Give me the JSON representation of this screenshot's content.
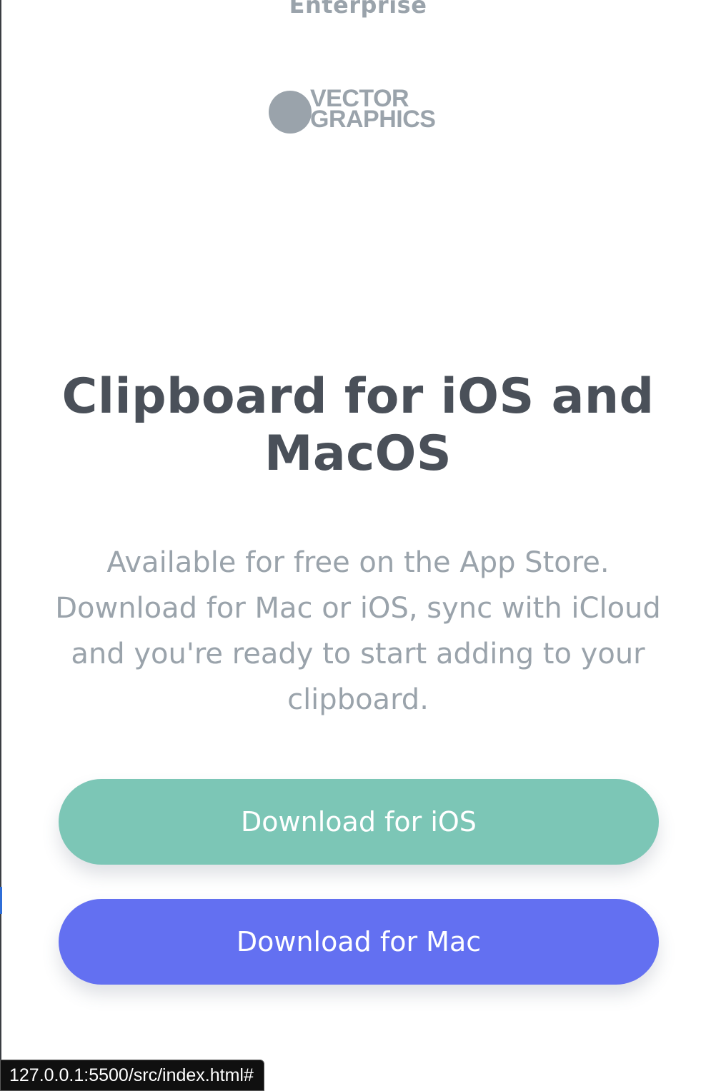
{
  "header": {
    "enterprise_label": "Enterprise"
  },
  "logo": {
    "line1": "VECTOR",
    "line2": "GRAPHICS"
  },
  "download_section": {
    "title": "Clipboard for iOS and MacOS",
    "description": "Available for free on the App Store. Download for Mac or iOS, sync with iCloud and you're ready to start adding to your clipboard.",
    "ios_button_label": "Download for iOS",
    "mac_button_label": "Download for Mac"
  },
  "status_bar": {
    "url": "127.0.0.1:5500/src/index.html#"
  },
  "colors": {
    "ios_button": "#7cc6b6",
    "mac_button": "#6370f1",
    "heading": "#4a5059",
    "muted": "#9aa3ab"
  }
}
